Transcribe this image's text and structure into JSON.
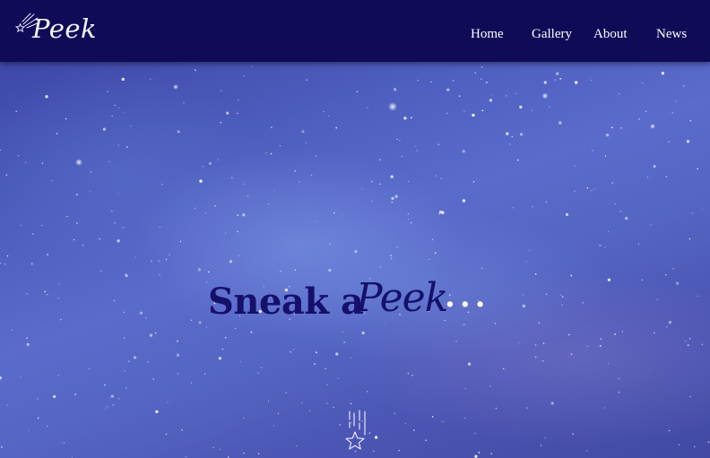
{
  "header": {
    "logo": {
      "text": "Peek",
      "icon": "shooting-star-icon"
    },
    "nav": [
      {
        "label": "Home"
      },
      {
        "label": "Gallery"
      },
      {
        "label": "About"
      },
      {
        "label": "News"
      }
    ]
  },
  "hero": {
    "headline_plain": "Sneak a",
    "headline_script": "Peek",
    "headline_dots": "...",
    "scroll_icon": "falling-star-icon"
  },
  "colors": {
    "header_bg": "#100b57",
    "headline_text": "#15106a",
    "nav_text": "#ffffff",
    "sky_mid": "#5a6bcb"
  }
}
